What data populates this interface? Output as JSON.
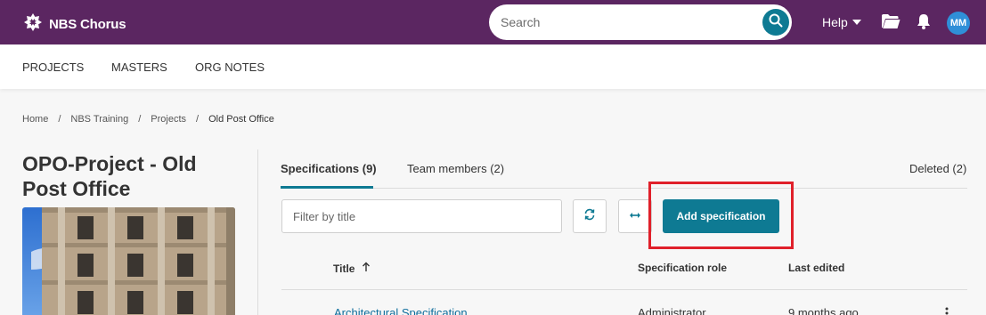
{
  "header": {
    "brand": "NBS Chorus",
    "search_placeholder": "Search",
    "help_label": "Help",
    "avatar_initials": "MM",
    "brand_color": "#5b2661",
    "accent_color": "#0e7a93"
  },
  "subnav": {
    "items": [
      "PROJECTS",
      "MASTERS",
      "ORG NOTES"
    ]
  },
  "breadcrumb": {
    "items": [
      "Home",
      "NBS Training",
      "Projects",
      "Old Post Office"
    ],
    "separator": "/"
  },
  "project": {
    "title": "OPO-Project - Old Post Office"
  },
  "tabs": {
    "specifications": "Specifications (9)",
    "team_members": "Team members (2)",
    "deleted": "Deleted (2)"
  },
  "toolbar": {
    "filter_placeholder": "Filter by title",
    "add_label": "Add specification"
  },
  "table": {
    "columns": [
      "Title",
      "Specification role",
      "Last edited"
    ],
    "rows": [
      {
        "title": "Architectural Specification",
        "role": "Administrator",
        "edited": "9 months ago"
      }
    ]
  },
  "icons": {
    "search": "search-icon",
    "folder": "folder-icon",
    "bell": "bell-icon",
    "refresh": "refresh-icon",
    "expand": "expand-horizontal-icon",
    "sort": "sort-up-icon",
    "menu": "more-vertical-icon"
  }
}
